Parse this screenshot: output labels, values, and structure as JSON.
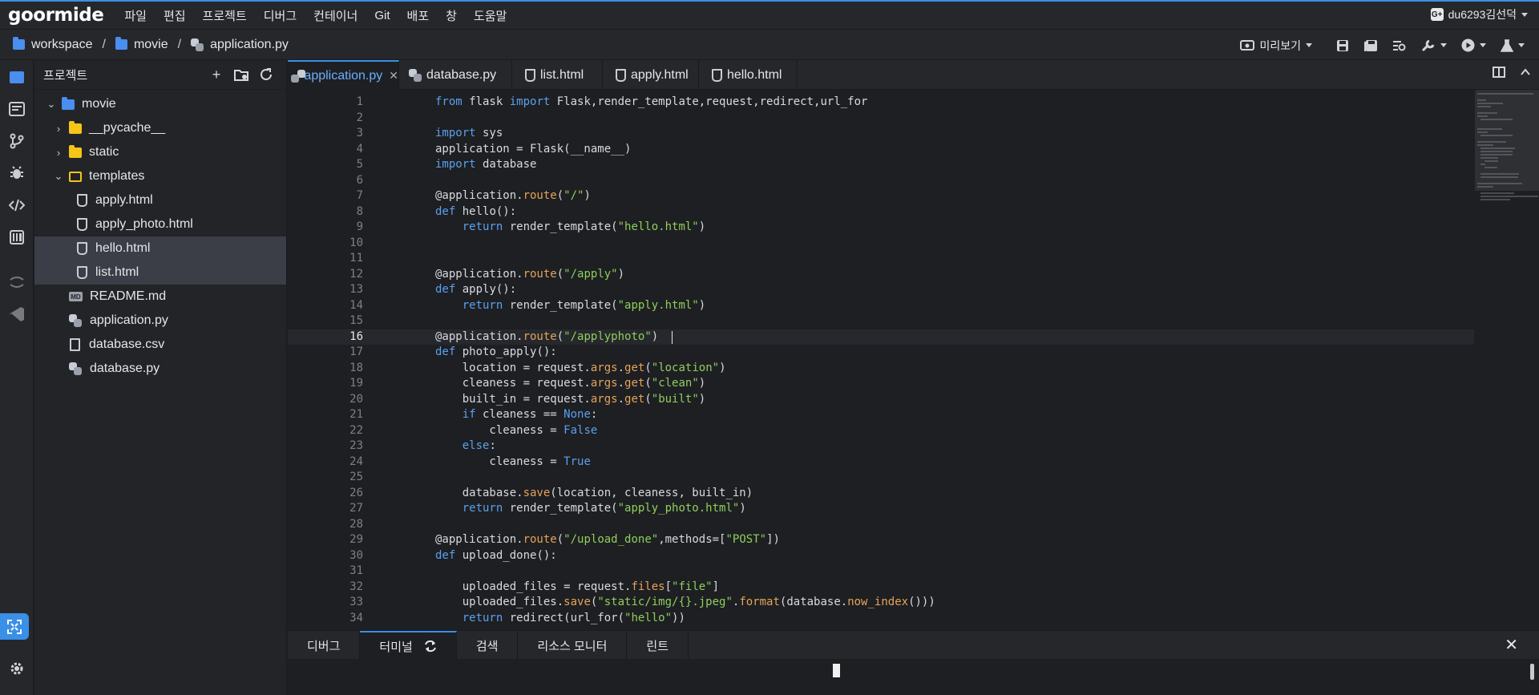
{
  "app": {
    "logo": "goormide",
    "menu": [
      "파일",
      "편집",
      "프로젝트",
      "디버그",
      "컨테이너",
      "Git",
      "배포",
      "창",
      "도움말"
    ],
    "user": {
      "badge": "G+",
      "name": "du6293김선덕"
    }
  },
  "breadcrumb": {
    "items": [
      "workspace",
      "movie",
      "application.py"
    ],
    "separator": "/"
  },
  "toolbar": {
    "preview_label": "미리보기"
  },
  "project_panel": {
    "title": "프로젝트",
    "tree": [
      {
        "name": "movie",
        "kind": "root-folder",
        "expanded": true
      },
      {
        "name": "__pycache__",
        "kind": "folder",
        "expanded": false
      },
      {
        "name": "static",
        "kind": "folder",
        "expanded": false
      },
      {
        "name": "templates",
        "kind": "folder",
        "expanded": true
      },
      {
        "name": "apply.html",
        "kind": "html"
      },
      {
        "name": "apply_photo.html",
        "kind": "html"
      },
      {
        "name": "hello.html",
        "kind": "html",
        "selected": true
      },
      {
        "name": "list.html",
        "kind": "html",
        "selected": true
      },
      {
        "name": "README.md",
        "kind": "md"
      },
      {
        "name": "application.py",
        "kind": "py"
      },
      {
        "name": "database.csv",
        "kind": "csv"
      },
      {
        "name": "database.py",
        "kind": "py"
      }
    ]
  },
  "editor": {
    "tabs": [
      {
        "label": "application.py",
        "icon": "python-icon",
        "active": true,
        "close": "✕"
      },
      {
        "label": "database.py",
        "icon": "python-icon",
        "active": false
      },
      {
        "label": "list.html",
        "icon": "html-icon",
        "active": false
      },
      {
        "label": "apply.html",
        "icon": "html-icon",
        "active": false
      },
      {
        "label": "hello.html",
        "icon": "html-icon",
        "active": false
      }
    ],
    "current_line": 16,
    "lines": [
      "from flask import Flask,render_template,request,redirect,url_for",
      "",
      "import sys",
      "application = Flask(__name__)",
      "import database",
      "",
      "@application.route(\"/\")",
      "def hello():",
      "    return render_template(\"hello.html\")",
      "",
      "",
      "@application.route(\"/apply\")",
      "def apply():",
      "    return render_template(\"apply.html\")",
      "",
      "@application.route(\"/applyphoto\")",
      "def photo_apply():",
      "    location = request.args.get(\"location\")",
      "    cleaness = request.args.get(\"clean\")",
      "    built_in = request.args.get(\"built\")",
      "    if cleaness == None:",
      "        cleaness = False",
      "    else:",
      "        cleaness = True",
      "",
      "    database.save(location, cleaness, built_in)",
      "    return render_template(\"apply_photo.html\")",
      "",
      "@application.route(\"/upload_done\",methods=[\"POST\"])",
      "def upload_done():",
      "",
      "    uploaded_files = request.files[\"file\"]",
      "    uploaded_files.save(\"static/img/{}.jpeg\".format(database.now_index()))",
      "    return redirect(url_for(\"hello\"))"
    ]
  },
  "bottom_panel": {
    "tabs": [
      "디버그",
      "터미널",
      "검색",
      "리소스 모니터",
      "린트"
    ],
    "active": "터미널",
    "close": "✕"
  },
  "colors": {
    "accent": "#3a8fe6",
    "keyword": "#5aa0f0",
    "string": "#8ecf5c",
    "method": "#e5a35a",
    "folder": "#f5c518",
    "background": "#1e1f22"
  }
}
